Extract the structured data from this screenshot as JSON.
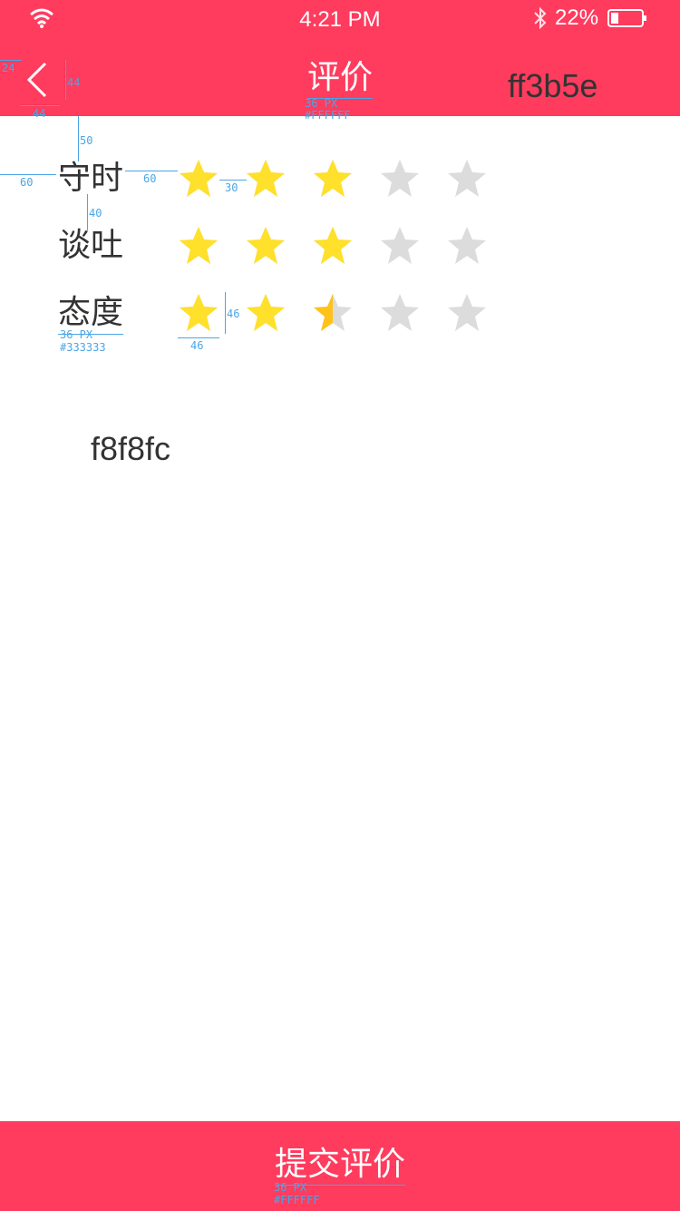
{
  "status_bar": {
    "time": "4:21 PM",
    "battery": "22%"
  },
  "header": {
    "title": "评价",
    "note": "ff3b5e"
  },
  "colors": {
    "brand": "#ff3b5e",
    "text": "#333333",
    "star_on": "#ffe02a",
    "star_off": "#dcdcdc",
    "annotation": "#4aa6e6"
  },
  "ratings": [
    {
      "label": "守时",
      "value": 3
    },
    {
      "label": "谈吐",
      "value": 3
    },
    {
      "label": "态度",
      "value": 2.5
    }
  ],
  "rating_max": 5,
  "background_note": "f8f8fc",
  "submit": {
    "label": "提交评价"
  },
  "annotations": {
    "header_back_size": "44",
    "back_left": "24",
    "back_height": "44",
    "title_font": "36 PX",
    "title_color": "#FFFFFF",
    "gap_top": "50",
    "gap_left": "60",
    "gap_label_star": "60",
    "gap_star": "30",
    "row_gap": "40",
    "label_font": "36 PX",
    "label_color": "#333333",
    "star_w": "46",
    "star_h": "46",
    "submit_font": "36 PX",
    "submit_color": "#FFFFFF"
  },
  "icons": [
    "wifi-icon",
    "bluetooth-icon",
    "battery-icon",
    "back-chevron-icon",
    "star-icon"
  ]
}
